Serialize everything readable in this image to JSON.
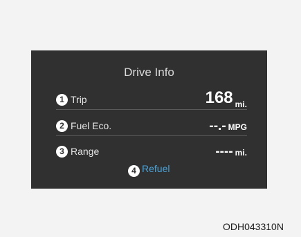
{
  "screen": {
    "title": "Drive Info",
    "rows": [
      {
        "badge": "1",
        "label": "Trip",
        "value": "168",
        "unit": "mi."
      },
      {
        "badge": "2",
        "label": "Fuel Eco.",
        "value": "--.-",
        "unit": "MPG"
      },
      {
        "badge": "3",
        "label": "Range",
        "value": "----",
        "unit": "mi."
      }
    ],
    "refuel": {
      "badge": "4",
      "label": "Refuel",
      "color": "#4ba3da"
    },
    "background_color": "#303030"
  },
  "figure_code": "ODH043310N"
}
